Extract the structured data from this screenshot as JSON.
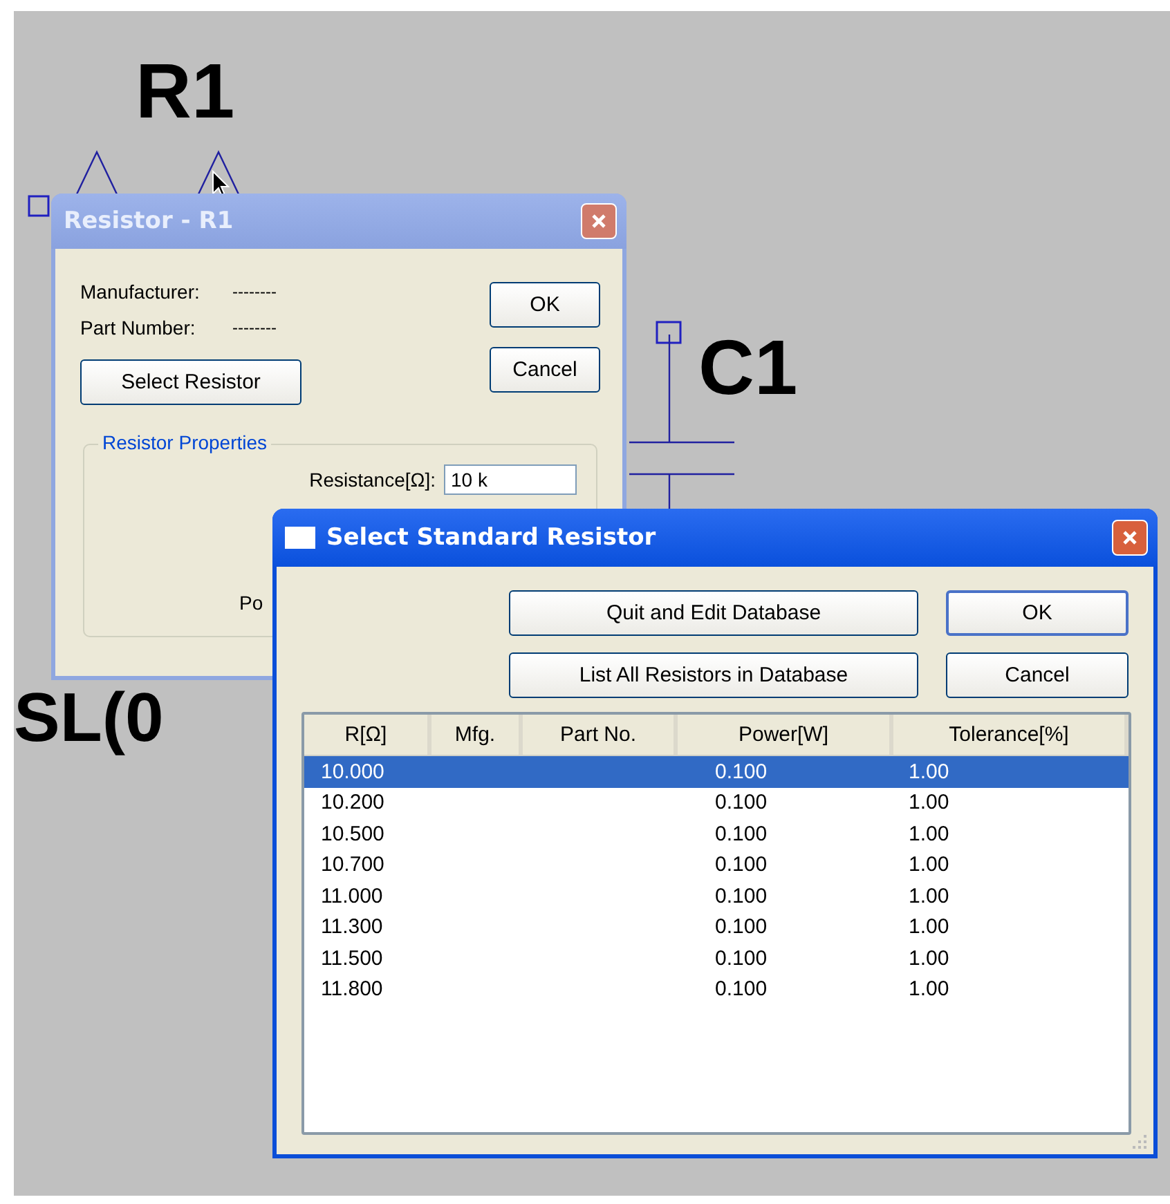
{
  "schematic": {
    "labels": [
      "R1",
      "C1",
      "SL(0"
    ]
  },
  "resistor_dialog": {
    "title": "Resistor - R1",
    "active": false,
    "fields": [
      {
        "label": "Manufacturer:",
        "value": "--------"
      },
      {
        "label": "Part Number:",
        "value": "--------"
      }
    ],
    "buttons": [
      "OK",
      "Cancel"
    ],
    "select_button": "Select Resistor",
    "group": {
      "title": "Resistor Properties",
      "resistance": {
        "label": "Resistance[Ω]:",
        "value": "10 k"
      },
      "partial_label": "Po"
    }
  },
  "select_dialog": {
    "title": "Select Standard Resistor",
    "active": true,
    "buttons": [
      "Quit and Edit Database",
      "List All Resistors in Database"
    ],
    "side_buttons": [
      "OK",
      "Cancel"
    ],
    "table": {
      "columns": [
        "R[Ω]",
        "Mfg.",
        "Part No.",
        "Power[W]",
        "Tolerance[%]"
      ],
      "rows": [
        {
          "r": "10.000",
          "power": "0.100",
          "tolerance": "1.00",
          "selected": true
        },
        {
          "r": "10.200",
          "power": "0.100",
          "tolerance": "1.00",
          "selected": false
        },
        {
          "r": "10.500",
          "power": "0.100",
          "tolerance": "1.00",
          "selected": false
        },
        {
          "r": "10.700",
          "power": "0.100",
          "tolerance": "1.00",
          "selected": false
        },
        {
          "r": "11.000",
          "power": "0.100",
          "tolerance": "1.00",
          "selected": false
        },
        {
          "r": "11.300",
          "power": "0.100",
          "tolerance": "1.00",
          "selected": false
        },
        {
          "r": "11.500",
          "power": "0.100",
          "tolerance": "1.00",
          "selected": false
        },
        {
          "r": "11.800",
          "power": "0.100",
          "tolerance": "1.00",
          "selected": false
        }
      ]
    }
  }
}
